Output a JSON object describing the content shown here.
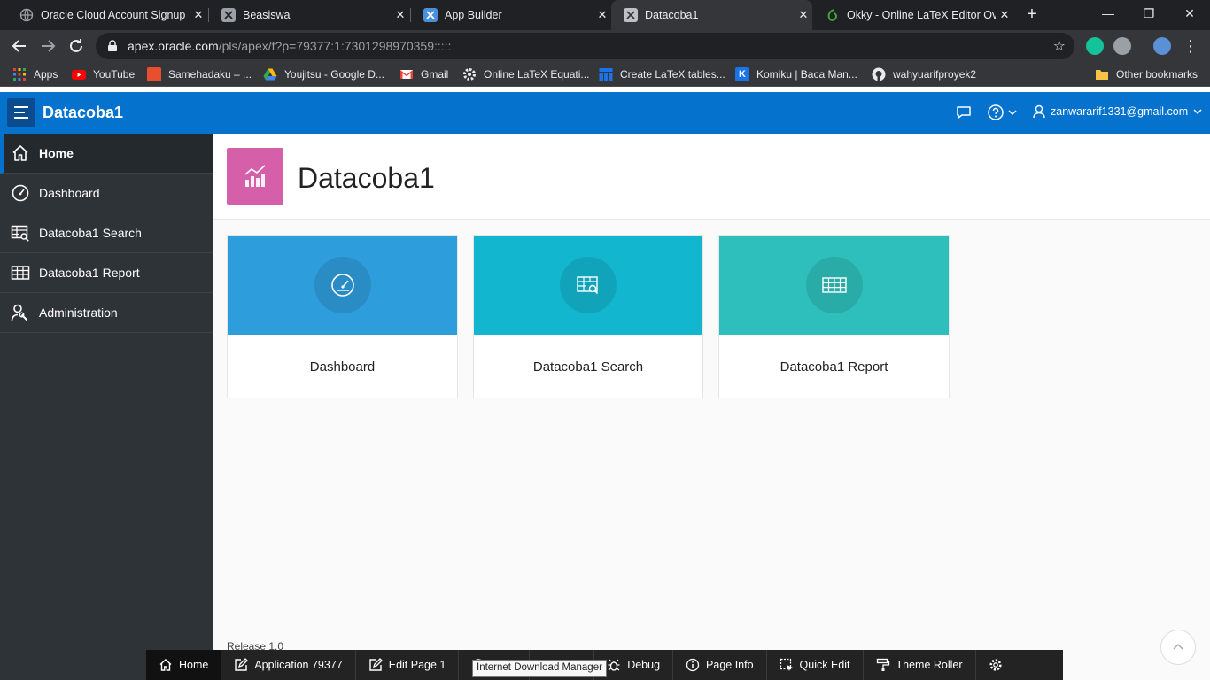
{
  "browser": {
    "tabs": [
      {
        "title": "Oracle Cloud Account Signup",
        "icon": "globe-icon"
      },
      {
        "title": "Beasiswa",
        "icon": "apex-icon"
      },
      {
        "title": "App Builder",
        "icon": "apex-icon"
      },
      {
        "title": "Datacoba1",
        "icon": "apex-icon"
      },
      {
        "title": "Okky - Online LaTeX Editor Ove",
        "icon": "overleaf-icon"
      }
    ],
    "url_host": "apex.oracle.com",
    "url_path": "/pls/apex/f?p=79377:1:7301298970359:::::",
    "bookmarks": [
      {
        "label": "Apps"
      },
      {
        "label": "YouTube"
      },
      {
        "label": "Samehadaku – ..."
      },
      {
        "label": "Youjitsu - Google D..."
      },
      {
        "label": "Gmail"
      },
      {
        "label": "Online LaTeX Equati..."
      },
      {
        "label": "Create LaTeX tables..."
      },
      {
        "label": "Komiku | Baca Man..."
      },
      {
        "label": "wahyuarifproyek2"
      },
      {
        "label": "Other bookmarks"
      }
    ]
  },
  "header": {
    "app_title": "Datacoba1",
    "user": "zanwararif1331@gmail.com"
  },
  "sidebar": {
    "items": [
      {
        "label": "Home",
        "icon": "home-icon"
      },
      {
        "label": "Dashboard",
        "icon": "gauge-icon"
      },
      {
        "label": "Datacoba1 Search",
        "icon": "table-search-icon"
      },
      {
        "label": "Datacoba1 Report",
        "icon": "table-icon"
      },
      {
        "label": "Administration",
        "icon": "user-wrench-icon"
      }
    ]
  },
  "main": {
    "title": "Datacoba1",
    "cards": [
      {
        "label": "Dashboard",
        "color": "#2e9ddb"
      },
      {
        "label": "Datacoba1 Search",
        "color": "#13b6cf"
      },
      {
        "label": "Datacoba1 Report",
        "color": "#2ebfbc"
      }
    ],
    "release": "Release 1.0"
  },
  "devbar": {
    "items": [
      {
        "label": "Home"
      },
      {
        "label": "Application 79377"
      },
      {
        "label": "Edit Page 1"
      },
      {
        "label": ""
      },
      {
        "label": "ebug"
      },
      {
        "label": "Debug"
      },
      {
        "label": "Page Info"
      },
      {
        "label": "Quick Edit"
      },
      {
        "label": "Theme Roller"
      }
    ],
    "tooltip": "Internet Download Manager"
  }
}
